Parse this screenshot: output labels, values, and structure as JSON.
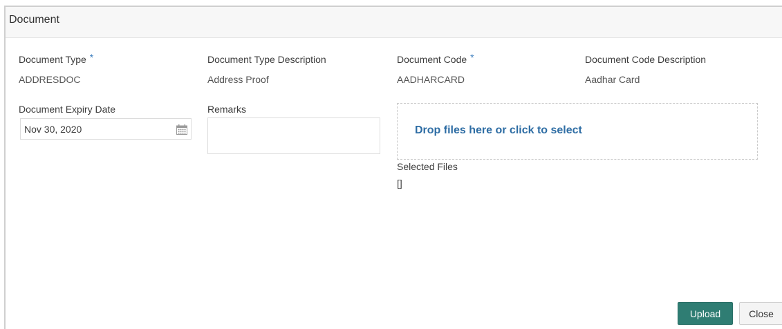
{
  "panel": {
    "title": "Document"
  },
  "fields": {
    "document_type": {
      "label": "Document Type",
      "required": "*",
      "value": "ADDRESDOC"
    },
    "document_type_description": {
      "label": "Document Type Description",
      "value": "Address Proof"
    },
    "document_code": {
      "label": "Document Code",
      "required": "*",
      "value": "AADHARCARD"
    },
    "document_code_description": {
      "label": "Document Code Description",
      "value": "Aadhar Card"
    },
    "document_expiry_date": {
      "label": "Document Expiry Date",
      "value": "Nov 30, 2020",
      "icon": "calendar-icon"
    },
    "remarks": {
      "label": "Remarks",
      "value": ""
    }
  },
  "dropzone": {
    "text": "Drop files here or click to select"
  },
  "selected_files": {
    "label": "Selected Files",
    "value": "[]"
  },
  "buttons": {
    "upload": "Upload",
    "close": "Close"
  },
  "colors": {
    "accent": "#2f7d73",
    "link": "#2e6da4",
    "required": "#3f7fbf"
  }
}
